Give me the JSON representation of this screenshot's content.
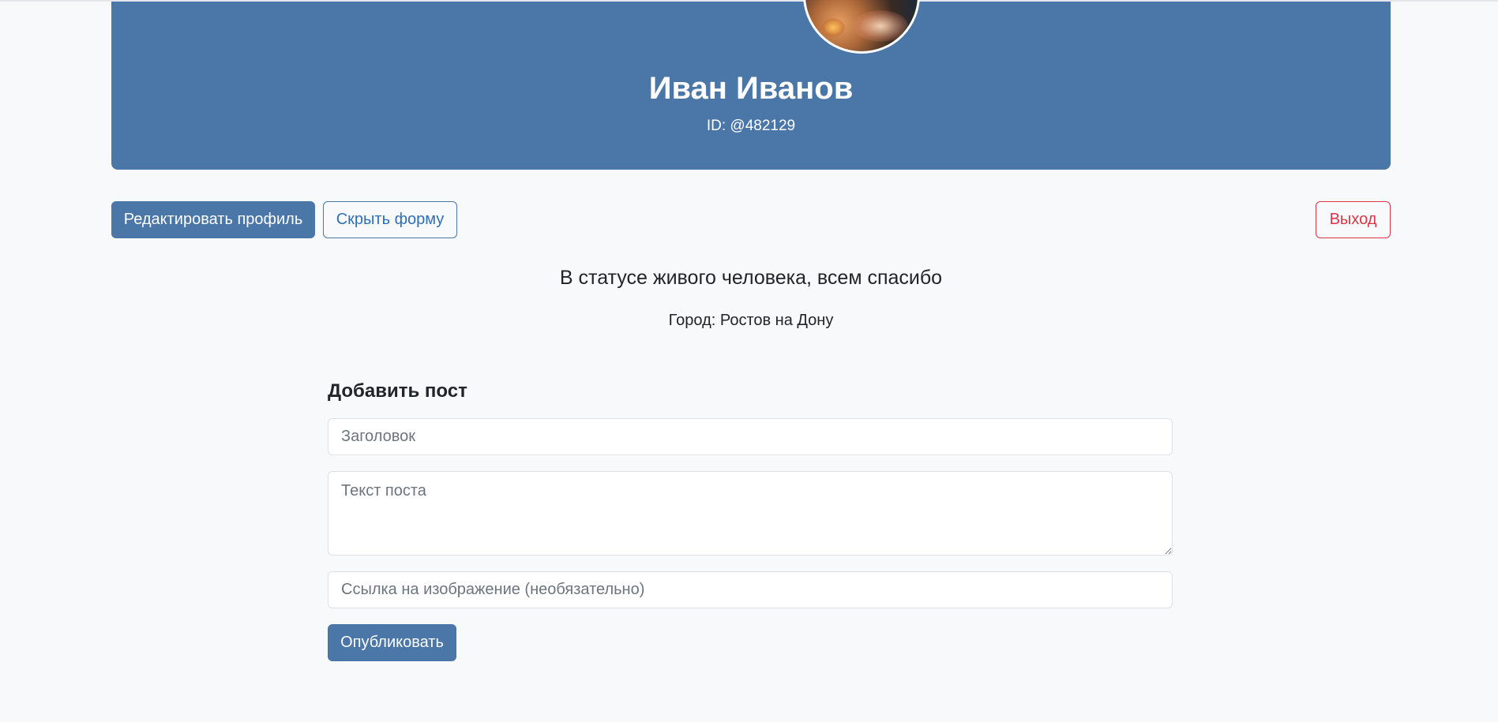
{
  "profile": {
    "name": "Иван Иванов",
    "id_text": "ID: @482129",
    "avatar_icon": "avatar-photo"
  },
  "actions": {
    "edit_label": "Редактировать профиль",
    "hide_form_label": "Скрыть форму",
    "logout_label": "Выход"
  },
  "info": {
    "status": "В статусе живого человека, всем спасибо",
    "city_label": "Город:",
    "city_value": "Ростов на Дону"
  },
  "post_form": {
    "title": "Добавить пост",
    "title_placeholder": "Заголовок",
    "text_placeholder": "Текст поста",
    "image_placeholder": "Ссылка на изображение (необязательно)",
    "publish_label": "Опубликовать"
  },
  "colors": {
    "header_bg": "#4a76a8",
    "primary": "#4a76a8",
    "danger": "#dc3545",
    "page_bg": "#f8f9fa"
  }
}
